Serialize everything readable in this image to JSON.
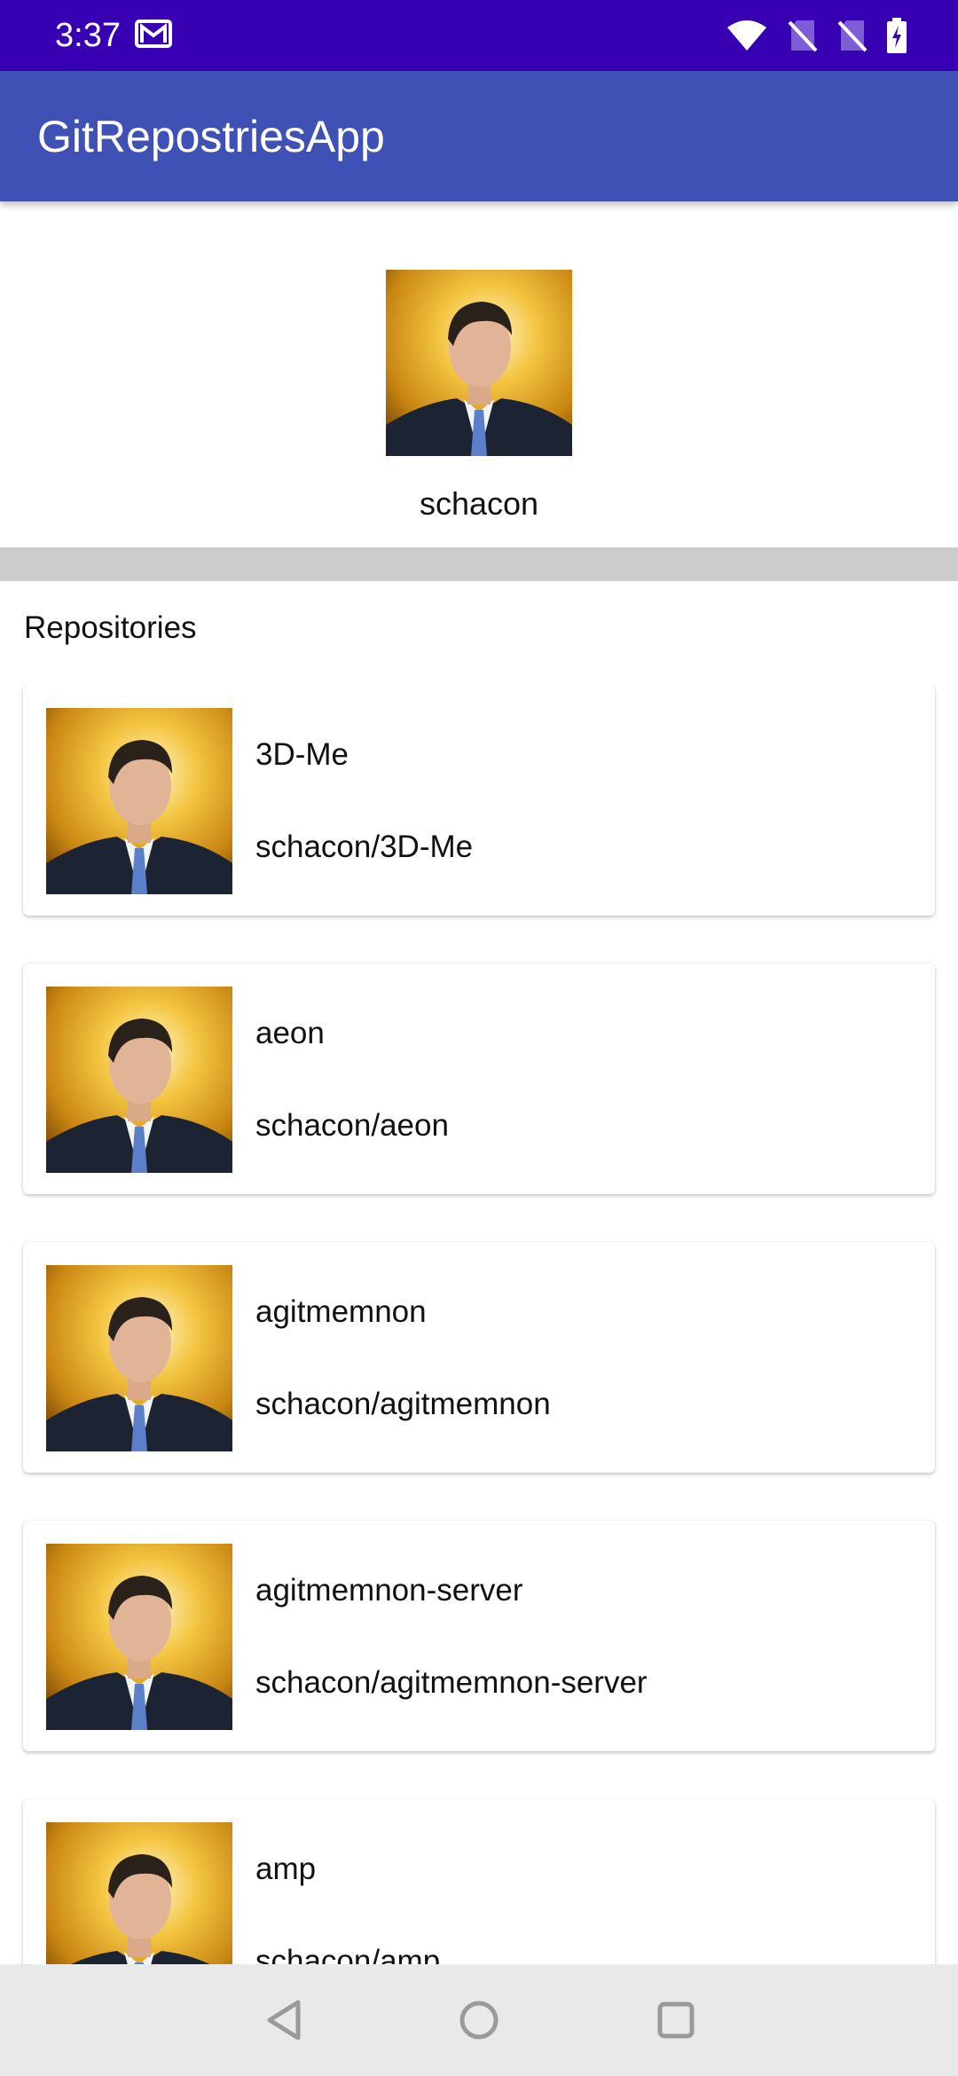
{
  "status_bar": {
    "time": "3:37",
    "icons": [
      "gmail-icon",
      "wifi-icon",
      "no-sim-icon",
      "no-sim-icon",
      "battery-charging-icon"
    ],
    "color": "#3700b3"
  },
  "app_bar": {
    "title": "GitRepostriesApp",
    "color": "#3f51b5"
  },
  "profile": {
    "username": "schacon",
    "avatar": "user-avatar"
  },
  "repositories": {
    "section_label": "Repositories",
    "items": [
      {
        "name": "3D-Me",
        "full_name": "schacon/3D-Me"
      },
      {
        "name": "aeon",
        "full_name": "schacon/aeon"
      },
      {
        "name": "agitmemnon",
        "full_name": "schacon/agitmemnon"
      },
      {
        "name": "agitmemnon-server",
        "full_name": "schacon/agitmemnon-server"
      },
      {
        "name": "amp",
        "full_name": "schacon/amp"
      }
    ]
  },
  "nav_bar": {
    "buttons": [
      "back-icon",
      "home-icon",
      "recents-icon"
    ]
  }
}
